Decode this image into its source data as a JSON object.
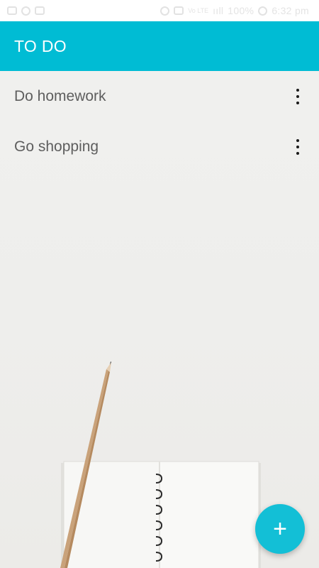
{
  "status_bar": {
    "network": "Vo LTE",
    "signal_label": "ııll",
    "battery": "100%",
    "time": "6:32 pm"
  },
  "app_bar": {
    "title": "TO DO"
  },
  "todos": [
    {
      "label": "Do homework",
      "menu_icon": "more-vert-icon"
    },
    {
      "label": "Go shopping",
      "menu_icon": "more-vert-icon"
    }
  ],
  "fab": {
    "icon": "+",
    "icon_name": "add-icon"
  },
  "colors": {
    "primary": "#00bcd4",
    "fab": "#13bfd6",
    "text": "#5e5e5e",
    "background": "#efefed"
  }
}
